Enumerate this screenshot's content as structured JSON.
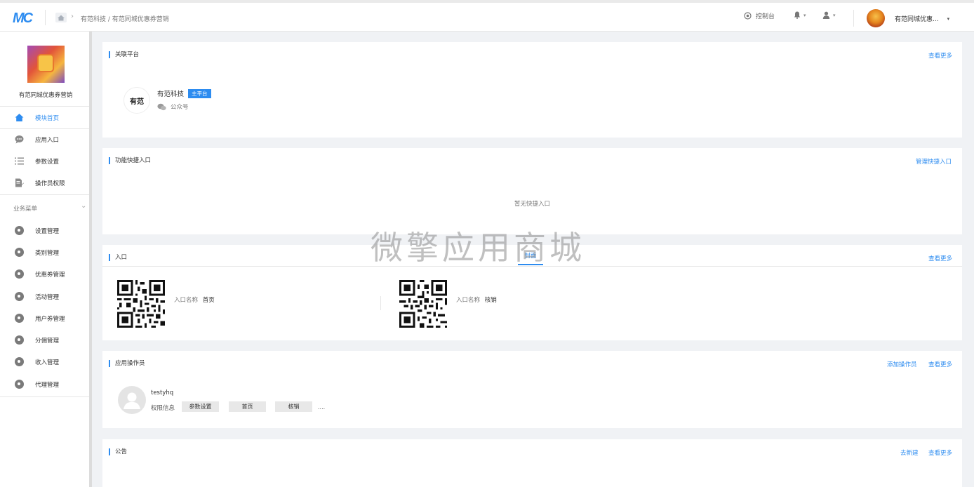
{
  "topbar": {
    "logo_text": "MC",
    "home_icon": "home-icon",
    "breadcrumb": "有范科技 / 有范同城优惠券营销",
    "console_label": "控制台",
    "console_icon": "target-icon",
    "bell_icon": "bell-icon",
    "user_icon": "user-icon",
    "account_name": "有范同城优惠...",
    "account_caret": "▾"
  },
  "sidebar": {
    "app_title": "有范同城优惠券营销",
    "items": [
      {
        "label": "模块首页",
        "icon": "home-icon",
        "active": true
      },
      {
        "label": "应用入口",
        "icon": "chat-icon"
      },
      {
        "label": "参数设置",
        "icon": "list-icon"
      },
      {
        "label": "操作员权限",
        "icon": "edit-doc-icon"
      }
    ],
    "section_label": "业务菜单",
    "business_items": [
      {
        "label": "设置管理",
        "icon": "gear-icon"
      },
      {
        "label": "类别管理",
        "icon": "gear-icon"
      },
      {
        "label": "优惠券管理",
        "icon": "gear-icon"
      },
      {
        "label": "活动管理",
        "icon": "gear-icon"
      },
      {
        "label": "用户券管理",
        "icon": "gear-icon"
      },
      {
        "label": "分佣管理",
        "icon": "gear-icon"
      },
      {
        "label": "收入管理",
        "icon": "gear-icon"
      },
      {
        "label": "代理管理",
        "icon": "gear-icon"
      }
    ]
  },
  "panels": {
    "platform": {
      "title": "关联平台",
      "link": "查看更多",
      "name": "有范科技",
      "badge": "主平台",
      "type": "公众号",
      "logo_text": "有范"
    },
    "shortcuts": {
      "title": "功能快捷入口",
      "link": "管理快捷入口",
      "empty": "暂无快捷入口"
    },
    "entry": {
      "title": "入口",
      "tab": "封面",
      "link": "查看更多",
      "items": [
        {
          "name_label": "入口名称",
          "name": "首页"
        },
        {
          "name_label": "入口名称",
          "name": "核销"
        }
      ]
    },
    "operators": {
      "title": "应用操作员",
      "add_link": "添加操作员",
      "link": "查看更多",
      "user": "testyhq",
      "perm_label": "权限信息",
      "perms": [
        "参数设置",
        "首页",
        "核销"
      ],
      "more": "...."
    },
    "notice": {
      "title": "公告",
      "new_link": "去新建",
      "link": "查看更多"
    }
  },
  "watermark": "微擎应用商城",
  "colors": {
    "accent": "#2d8cf0",
    "background": "#f0f2f5"
  }
}
